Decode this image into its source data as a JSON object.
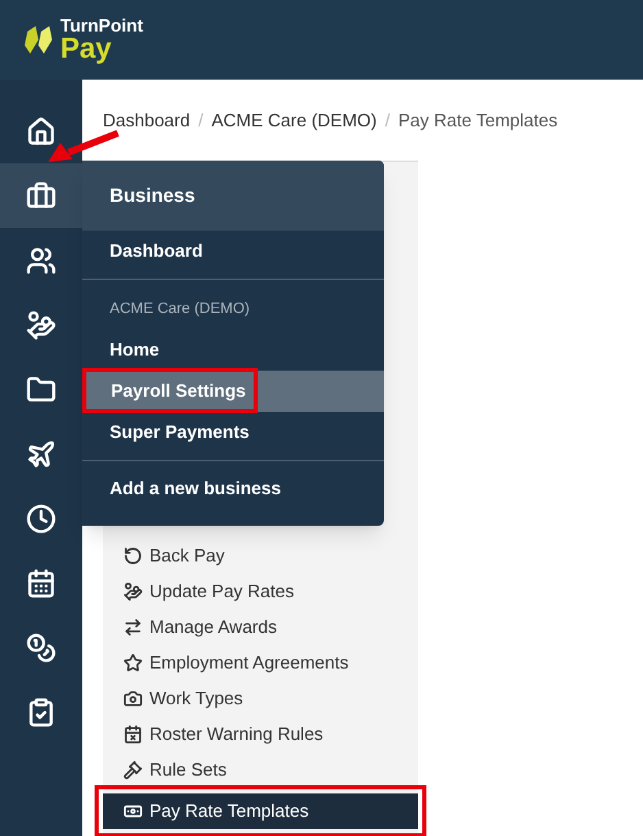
{
  "logo": {
    "line1": "TurnPoint",
    "line2": "Pay"
  },
  "rail": [
    {
      "kind": "home",
      "selected": false
    },
    {
      "kind": "briefcase",
      "selected": true
    },
    {
      "kind": "people",
      "selected": false
    },
    {
      "kind": "hand-coin",
      "selected": false
    },
    {
      "kind": "folder",
      "selected": false
    },
    {
      "kind": "plane",
      "selected": false
    },
    {
      "kind": "clock",
      "selected": false
    },
    {
      "kind": "calendar",
      "selected": false
    },
    {
      "kind": "coins",
      "selected": false
    },
    {
      "kind": "clipboard",
      "selected": false
    }
  ],
  "pointer_arrow": true,
  "breadcrumb": [
    {
      "label": "Dashboard",
      "separator": "/"
    },
    {
      "label": "ACME Care (DEMO)",
      "separator": "/"
    },
    {
      "label": "Pay Rate Templates"
    }
  ],
  "flyout": {
    "title": "Business",
    "items": [
      {
        "kind": "item",
        "label": "Dashboard",
        "selected": false,
        "highlighted": false
      },
      {
        "kind": "divider"
      },
      {
        "kind": "section",
        "label": "ACME Care (DEMO)"
      },
      {
        "kind": "item",
        "label": "Home",
        "selected": false,
        "highlighted": false
      },
      {
        "kind": "item",
        "label": "Payroll Settings",
        "selected": true,
        "highlighted": true
      },
      {
        "kind": "item",
        "label": "Super Payments",
        "selected": false,
        "highlighted": false
      },
      {
        "kind": "divider"
      },
      {
        "kind": "item",
        "label": "Add a new business",
        "selected": false,
        "highlighted": false
      }
    ]
  },
  "submenu": [
    {
      "kind": "back",
      "label": "Back Pay",
      "selected": false,
      "highlighted": false
    },
    {
      "kind": "update",
      "label": "Update Pay Rates",
      "selected": false,
      "highlighted": false
    },
    {
      "kind": "swap",
      "label": "Manage Awards",
      "selected": false,
      "highlighted": false
    },
    {
      "kind": "star",
      "label": "Employment Agreements",
      "selected": false,
      "highlighted": false
    },
    {
      "kind": "worktype",
      "label": "Work Types",
      "selected": false,
      "highlighted": false
    },
    {
      "kind": "roster",
      "label": "Roster Warning Rules",
      "selected": false,
      "highlighted": false
    },
    {
      "kind": "gavel",
      "label": "Rule Sets",
      "selected": false,
      "highlighted": false
    },
    {
      "kind": "money",
      "label": "Pay Rate Templates",
      "selected": true,
      "highlighted": true
    }
  ]
}
